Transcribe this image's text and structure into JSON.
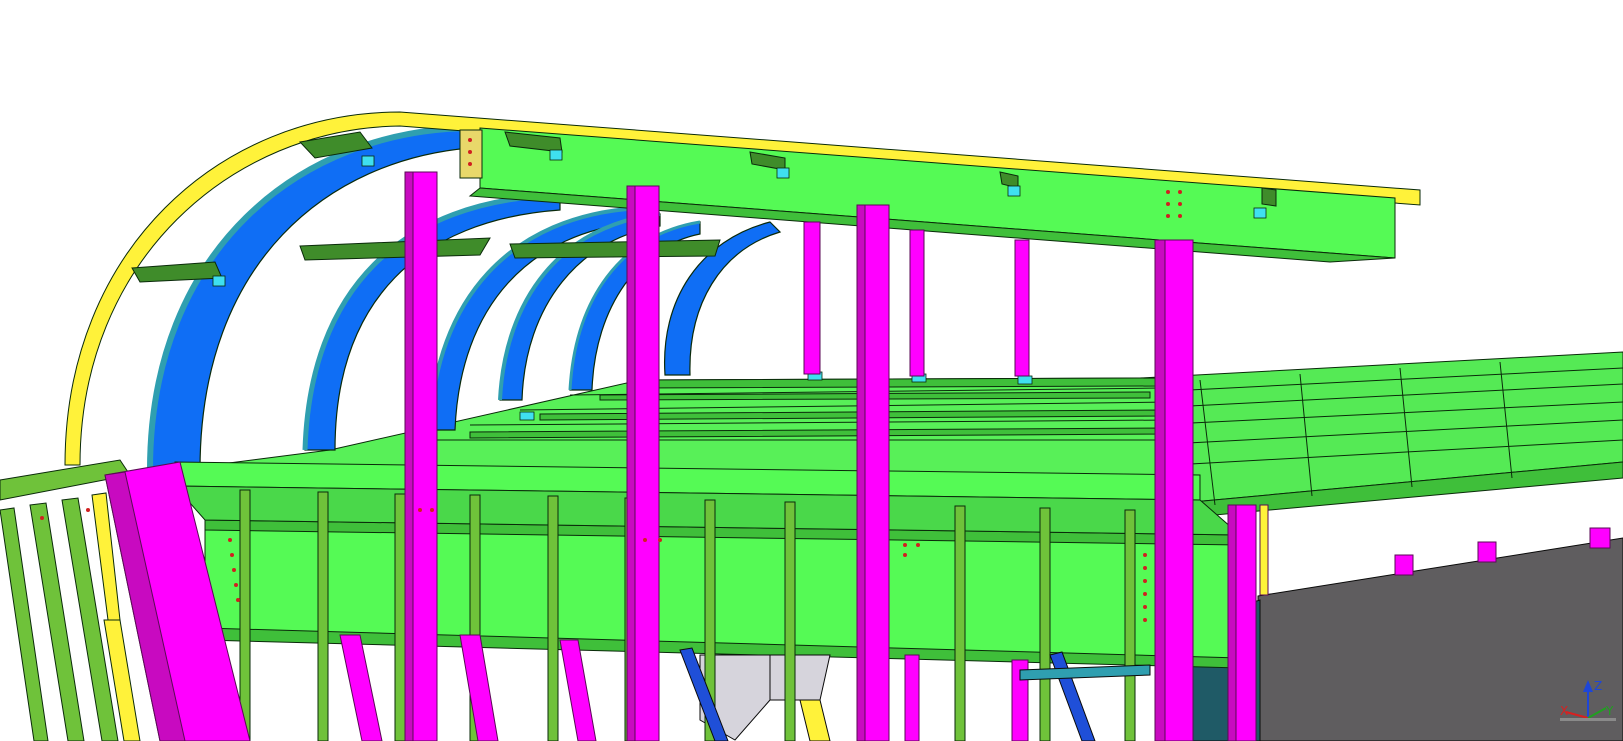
{
  "colors": {
    "background": "#ffffff",
    "primary_beam_green": "#55fa55",
    "dark_green": "#3a9c2e",
    "stud_green": "#6fc23a",
    "column_magenta": "#ff00ff",
    "column_dark": "#a8109a",
    "arch_blue": "#0f6ef5",
    "arch_teal": "#2f9fb0",
    "edge_yellow": "#fff23a",
    "panel_grey": "#5f5d5f",
    "plate_cyan": "#3fe0f0",
    "gusset_light": "#d6d4dc",
    "outline": "#0a2a0a"
  },
  "axis_indicator": {
    "z_label": "Z",
    "x_label": "X",
    "y_label": "Y",
    "z_color": "#1e46d8",
    "x_color": "#d82020",
    "y_color": "#20a020"
  },
  "scene": {
    "icon": "structural-steel-model",
    "view": "3d-perspective"
  }
}
